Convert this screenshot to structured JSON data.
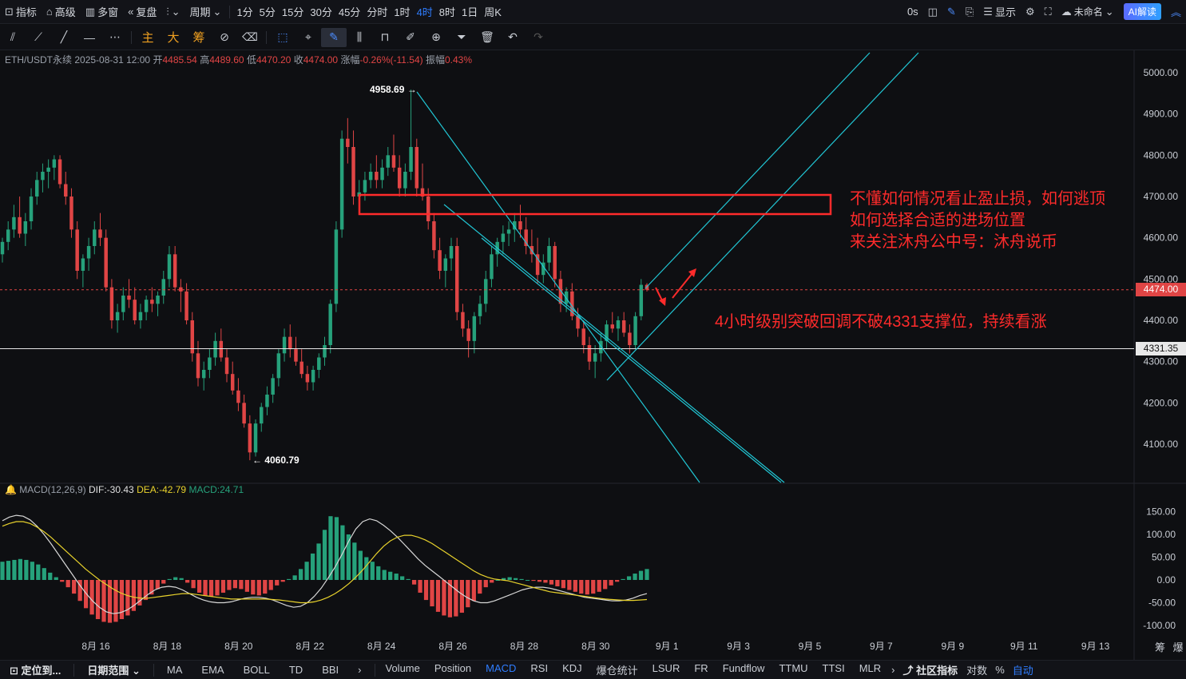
{
  "topbar": {
    "indicator_label": "指标",
    "advanced_label": "高级",
    "multi_window_label": "多窗",
    "replay_label": "复盘",
    "period_label": "周期",
    "periods": [
      "1分",
      "5分",
      "15分",
      "30分",
      "45分",
      "分时",
      "1时",
      "4时",
      "8时",
      "1日",
      "周K"
    ],
    "active_period": "4时",
    "timer": "0s",
    "display_label": "显示",
    "layout_name": "未命名",
    "ai_label": "AI解读"
  },
  "toolbar": {
    "main_label": "主",
    "big_label": "大",
    "chips_label": "筹"
  },
  "info": {
    "symbol": "ETH/USDT永续",
    "time": "2025-08-31 12:00",
    "open_label": "开",
    "open": "4485.54",
    "high_label": "高",
    "high": "4489.60",
    "low_label": "低",
    "low": "4470.20",
    "close_label": "收",
    "close": "4474.00",
    "change_label": "涨幅",
    "change": "-0.26%(-11.54)",
    "amplitude_label": "振幅",
    "amplitude": "0.43%"
  },
  "macd_info": {
    "name": "MACD(12,26,9)",
    "dif": "DIF:-30.43",
    "dea": "DEA:-42.79",
    "macd": "MACD:24.71"
  },
  "annotations": {
    "box_text_1": "不懂如何情况看止盈止损，如何逃顶",
    "box_text_2": "如何选择合适的进场位置",
    "box_text_3": "来关注沐舟公中号：沐舟说币",
    "support_text": "4小时级别突破回调不破4331支撑位，持续看涨"
  },
  "price_tags": {
    "current": "4474.00",
    "support": "4331.35"
  },
  "extreme_labels": {
    "high": "4958.69",
    "low": "4060.79"
  },
  "bottombar": {
    "locate_label": "定位到...",
    "date_range_label": "日期范围",
    "overlays": [
      "MA",
      "EMA",
      "BOLL",
      "TD",
      "BBI"
    ],
    "subcharts": [
      "Volume",
      "Position",
      "MACD",
      "RSI",
      "KDJ",
      "爆仓统计",
      "LSUR",
      "FR",
      "Fundflow",
      "TTMU",
      "TTSI",
      "MLR"
    ],
    "active_subchart": "MACD",
    "community_label": "社区指标",
    "log_label": "对数",
    "percent_label": "%",
    "auto_label": "自动"
  },
  "right_corner": {
    "chips": "筹",
    "burst": "爆"
  },
  "colors": {
    "up": "#26a17b",
    "down": "#e04545",
    "trend": "#21c6d4",
    "annotation": "#ff2b2b",
    "dea": "#e8d22c",
    "dif": "#d8d8d8"
  },
  "chart_data": {
    "type": "candlestick",
    "main": {
      "yticks": [
        4100,
        4200,
        4300,
        4400,
        4500,
        4600,
        4700,
        4800,
        4900,
        5000
      ],
      "ytick_labels": [
        "4100.00",
        "4200.00",
        "4300.00",
        "4400.00",
        "4500.00",
        "4600.00",
        "4700.00",
        "4800.00",
        "4900.00",
        "5000.00"
      ],
      "ylim": [
        4004,
        5052
      ],
      "support_level": 4331.35,
      "current_price": 4474.0,
      "marked_high": 4958.69,
      "marked_low": 4060.79,
      "candles": [
        [
          4560,
          4600,
          4540,
          4590
        ],
        [
          4590,
          4640,
          4570,
          4620
        ],
        [
          4620,
          4680,
          4600,
          4650
        ],
        [
          4650,
          4700,
          4600,
          4610
        ],
        [
          4610,
          4660,
          4580,
          4640
        ],
        [
          4640,
          4720,
          4620,
          4700
        ],
        [
          4700,
          4760,
          4680,
          4740
        ],
        [
          4740,
          4780,
          4710,
          4760
        ],
        [
          4760,
          4790,
          4720,
          4770
        ],
        [
          4770,
          4800,
          4740,
          4790
        ],
        [
          4790,
          4800,
          4720,
          4730
        ],
        [
          4730,
          4760,
          4680,
          4700
        ],
        [
          4700,
          4720,
          4600,
          4620
        ],
        [
          4620,
          4640,
          4500,
          4520
        ],
        [
          4520,
          4560,
          4480,
          4550
        ],
        [
          4550,
          4600,
          4520,
          4580
        ],
        [
          4580,
          4640,
          4560,
          4620
        ],
        [
          4620,
          4660,
          4580,
          4600
        ],
        [
          4600,
          4620,
          4470,
          4480
        ],
        [
          4480,
          4500,
          4380,
          4400
        ],
        [
          4400,
          4440,
          4370,
          4420
        ],
        [
          4420,
          4480,
          4400,
          4460
        ],
        [
          4460,
          4500,
          4430,
          4450
        ],
        [
          4450,
          4480,
          4390,
          4400
        ],
        [
          4400,
          4440,
          4380,
          4420
        ],
        [
          4420,
          4460,
          4400,
          4450
        ],
        [
          4450,
          4480,
          4420,
          4440
        ],
        [
          4440,
          4470,
          4410,
          4460
        ],
        [
          4460,
          4520,
          4440,
          4500
        ],
        [
          4500,
          4580,
          4480,
          4560
        ],
        [
          4560,
          4580,
          4470,
          4480
        ],
        [
          4480,
          4500,
          4420,
          4470
        ],
        [
          4470,
          4490,
          4390,
          4400
        ],
        [
          4400,
          4420,
          4300,
          4320
        ],
        [
          4320,
          4350,
          4240,
          4260
        ],
        [
          4260,
          4300,
          4230,
          4280
        ],
        [
          4280,
          4330,
          4260,
          4310
        ],
        [
          4310,
          4370,
          4290,
          4350
        ],
        [
          4350,
          4380,
          4300,
          4310
        ],
        [
          4310,
          4330,
          4250,
          4270
        ],
        [
          4270,
          4300,
          4220,
          4230
        ],
        [
          4230,
          4260,
          4180,
          4200
        ],
        [
          4200,
          4220,
          4140,
          4150
        ],
        [
          4150,
          4170,
          4061,
          4080
        ],
        [
          4080,
          4160,
          4070,
          4150
        ],
        [
          4150,
          4200,
          4130,
          4190
        ],
        [
          4190,
          4240,
          4170,
          4220
        ],
        [
          4220,
          4270,
          4200,
          4260
        ],
        [
          4260,
          4330,
          4240,
          4320
        ],
        [
          4320,
          4380,
          4300,
          4360
        ],
        [
          4360,
          4390,
          4310,
          4330
        ],
        [
          4330,
          4360,
          4290,
          4300
        ],
        [
          4300,
          4330,
          4260,
          4270
        ],
        [
          4270,
          4290,
          4230,
          4250
        ],
        [
          4250,
          4290,
          4230,
          4280
        ],
        [
          4280,
          4320,
          4260,
          4310
        ],
        [
          4310,
          4360,
          4290,
          4340
        ],
        [
          4340,
          4450,
          4320,
          4440
        ],
        [
          4440,
          4640,
          4420,
          4620
        ],
        [
          4620,
          4860,
          4600,
          4840
        ],
        [
          4840,
          4890,
          4780,
          4820
        ],
        [
          4820,
          4860,
          4680,
          4700
        ],
        [
          4700,
          4740,
          4660,
          4710
        ],
        [
          4710,
          4760,
          4690,
          4740
        ],
        [
          4740,
          4780,
          4720,
          4760
        ],
        [
          4760,
          4800,
          4720,
          4740
        ],
        [
          4740,
          4790,
          4720,
          4770
        ],
        [
          4770,
          4820,
          4750,
          4800
        ],
        [
          4800,
          4850,
          4760,
          4770
        ],
        [
          4770,
          4800,
          4700,
          4720
        ],
        [
          4720,
          4780,
          4700,
          4760
        ],
        [
          4760,
          4959,
          4740,
          4820
        ],
        [
          4820,
          4840,
          4700,
          4720
        ],
        [
          4720,
          4780,
          4690,
          4700
        ],
        [
          4700,
          4720,
          4620,
          4640
        ],
        [
          4640,
          4660,
          4550,
          4570
        ],
        [
          4570,
          4600,
          4500,
          4520
        ],
        [
          4520,
          4560,
          4480,
          4550
        ],
        [
          4550,
          4600,
          4520,
          4580
        ],
        [
          4580,
          4600,
          4400,
          4420
        ],
        [
          4420,
          4440,
          4360,
          4380
        ],
        [
          4380,
          4400,
          4310,
          4350
        ],
        [
          4350,
          4420,
          4320,
          4410
        ],
        [
          4410,
          4460,
          4390,
          4440
        ],
        [
          4440,
          4520,
          4420,
          4500
        ],
        [
          4500,
          4580,
          4480,
          4560
        ],
        [
          4560,
          4600,
          4530,
          4590
        ],
        [
          4590,
          4630,
          4560,
          4610
        ],
        [
          4610,
          4640,
          4580,
          4620
        ],
        [
          4620,
          4660,
          4590,
          4640
        ],
        [
          4640,
          4680,
          4600,
          4620
        ],
        [
          4620,
          4650,
          4560,
          4580
        ],
        [
          4580,
          4620,
          4540,
          4560
        ],
        [
          4560,
          4600,
          4490,
          4510
        ],
        [
          4510,
          4560,
          4490,
          4540
        ],
        [
          4540,
          4600,
          4520,
          4580
        ],
        [
          4580,
          4590,
          4480,
          4500
        ],
        [
          4500,
          4520,
          4420,
          4440
        ],
        [
          4440,
          4480,
          4420,
          4470
        ],
        [
          4470,
          4490,
          4400,
          4410
        ],
        [
          4410,
          4430,
          4360,
          4380
        ],
        [
          4380,
          4400,
          4320,
          4340
        ],
        [
          4340,
          4360,
          4280,
          4300
        ],
        [
          4300,
          4340,
          4260,
          4320
        ],
        [
          4320,
          4370,
          4300,
          4350
        ],
        [
          4350,
          4400,
          4330,
          4390
        ],
        [
          4390,
          4420,
          4370,
          4380
        ],
        [
          4380,
          4410,
          4350,
          4400
        ],
        [
          4400,
          4420,
          4360,
          4370
        ],
        [
          4370,
          4390,
          4320,
          4340
        ],
        [
          4340,
          4420,
          4330,
          4410
        ],
        [
          4410,
          4500,
          4400,
          4486
        ],
        [
          4486,
          4490,
          4470,
          4474
        ]
      ]
    },
    "macd": {
      "yticks": [
        -100,
        -50,
        0,
        50,
        100,
        150
      ],
      "ytick_labels": [
        "-100.00",
        "-50.00",
        "0.00",
        "50.00",
        "100.00",
        "150.00"
      ],
      "ylim": [
        -120,
        170
      ],
      "hist": [
        40,
        42,
        44,
        46,
        44,
        40,
        34,
        26,
        16,
        6,
        -4,
        -16,
        -30,
        -46,
        -62,
        -76,
        -86,
        -92,
        -94,
        -92,
        -86,
        -78,
        -68,
        -56,
        -44,
        -32,
        -20,
        -8,
        2,
        6,
        4,
        -6,
        -18,
        -28,
        -34,
        -36,
        -34,
        -28,
        -22,
        -18,
        -20,
        -26,
        -32,
        -34,
        -30,
        -22,
        -12,
        -4,
        2,
        10,
        24,
        40,
        58,
        80,
        110,
        140,
        138,
        120,
        100,
        82,
        64,
        50,
        40,
        30,
        22,
        18,
        14,
        8,
        2,
        -10,
        -28,
        -44,
        -58,
        -70,
        -78,
        -82,
        -80,
        -72,
        -60,
        -46,
        -30,
        -16,
        -6,
        0,
        4,
        6,
        4,
        2,
        0,
        -2,
        -4,
        -6,
        -10,
        -14,
        -18,
        -22,
        -26,
        -30,
        -32,
        -30,
        -26,
        -20,
        -12,
        -4,
        2,
        8,
        14,
        20,
        24
      ],
      "dif": [
        130,
        138,
        142,
        140,
        132,
        118,
        100,
        80,
        58,
        36,
        14,
        -8,
        -28,
        -46,
        -60,
        -70,
        -74,
        -72,
        -66,
        -56,
        -44,
        -32,
        -22,
        -16,
        -14,
        -16,
        -22,
        -30,
        -38,
        -44,
        -48,
        -50,
        -50,
        -48,
        -44,
        -40,
        -38,
        -38,
        -40,
        -44,
        -50,
        -56,
        -60,
        -58,
        -50,
        -36,
        -18,
        4,
        28,
        56,
        86,
        112,
        128,
        134,
        130,
        120,
        108,
        94,
        78,
        62,
        46,
        32,
        20,
        8,
        -4,
        -16,
        -28,
        -38,
        -46,
        -50,
        -50,
        -46,
        -40,
        -34,
        -28,
        -22,
        -18,
        -16,
        -16,
        -18,
        -22,
        -26,
        -30,
        -34,
        -38,
        -40,
        -42,
        -44,
        -46,
        -46,
        -44,
        -40,
        -34,
        -30
      ],
      "dea": [
        118,
        124,
        128,
        128,
        124,
        116,
        106,
        94,
        80,
        66,
        52,
        38,
        24,
        12,
        0,
        -10,
        -20,
        -28,
        -34,
        -38,
        -40,
        -40,
        -38,
        -36,
        -34,
        -32,
        -30,
        -30,
        -32,
        -34,
        -36,
        -38,
        -40,
        -42,
        -42,
        -42,
        -42,
        -42,
        -42,
        -43,
        -44,
        -46,
        -48,
        -50,
        -50,
        -48,
        -44,
        -38,
        -30,
        -20,
        -8,
        6,
        22,
        40,
        58,
        74,
        86,
        94,
        98,
        98,
        94,
        88,
        80,
        70,
        60,
        50,
        40,
        30,
        20,
        12,
        6,
        2,
        0,
        -2,
        -6,
        -10,
        -14,
        -18,
        -22,
        -26,
        -28,
        -30,
        -32,
        -34,
        -36,
        -38,
        -40,
        -42,
        -43,
        -44,
        -45,
        -45,
        -44,
        -43
      ]
    },
    "x_tick_labels": [
      "8月 16",
      "8月 18",
      "8月 20",
      "8月 22",
      "8月 24",
      "8月 26",
      "8月 28",
      "8月 30",
      "9月 1",
      "9月 3",
      "9月 5",
      "9月 7",
      "9月 9",
      "9月 11",
      "9月 13"
    ]
  }
}
